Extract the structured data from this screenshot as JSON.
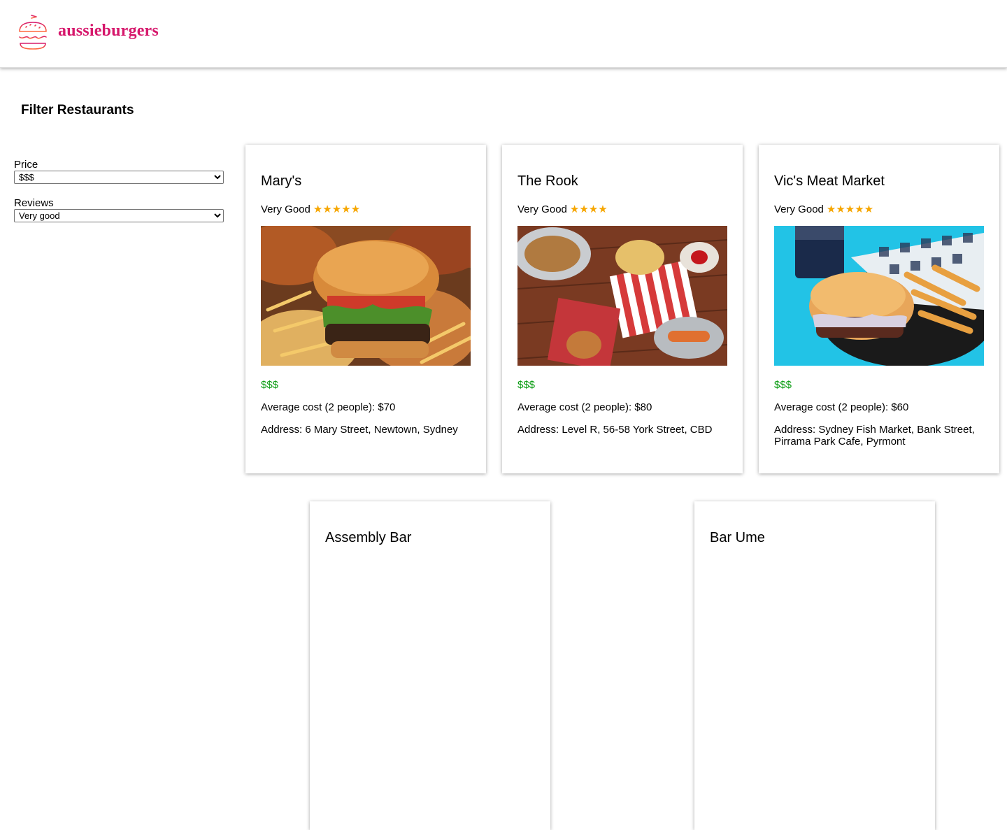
{
  "header": {
    "logo_text": "aussieburgers",
    "brand_color": "#d6186c"
  },
  "filters": {
    "title": "Filter Restaurants",
    "price": {
      "label": "Price",
      "selected": "$$$"
    },
    "reviews": {
      "label": "Reviews",
      "selected": "Very good"
    }
  },
  "restaurants": [
    {
      "name": "Mary's",
      "rating_text": "Very Good",
      "stars": 5,
      "price": "$$$",
      "cost": "Average cost (2 people): $70",
      "address": "Address: 6 Mary Street, Newtown, Sydney",
      "image": "burger-with-fries-photo"
    },
    {
      "name": "The Rook",
      "rating_text": "Very Good",
      "stars": 4,
      "price": "$$$",
      "cost": "Average cost (2 people): $80",
      "address": "Address: Level R, 56-58 York Street, CBD",
      "image": "table-spread-photo"
    },
    {
      "name": "Vic's Meat Market",
      "rating_text": "Very Good",
      "stars": 5,
      "price": "$$$",
      "cost": "Average cost (2 people): $60",
      "address": "Address: Sydney Fish Market, Bank Street, Pirrama Park Cafe, Pyrmont",
      "image": "burger-basket-photo"
    },
    {
      "name": "Assembly Bar"
    },
    {
      "name": "Bar Ume"
    }
  ],
  "colors": {
    "price": "#0a9c12",
    "star": "#f6a600"
  }
}
